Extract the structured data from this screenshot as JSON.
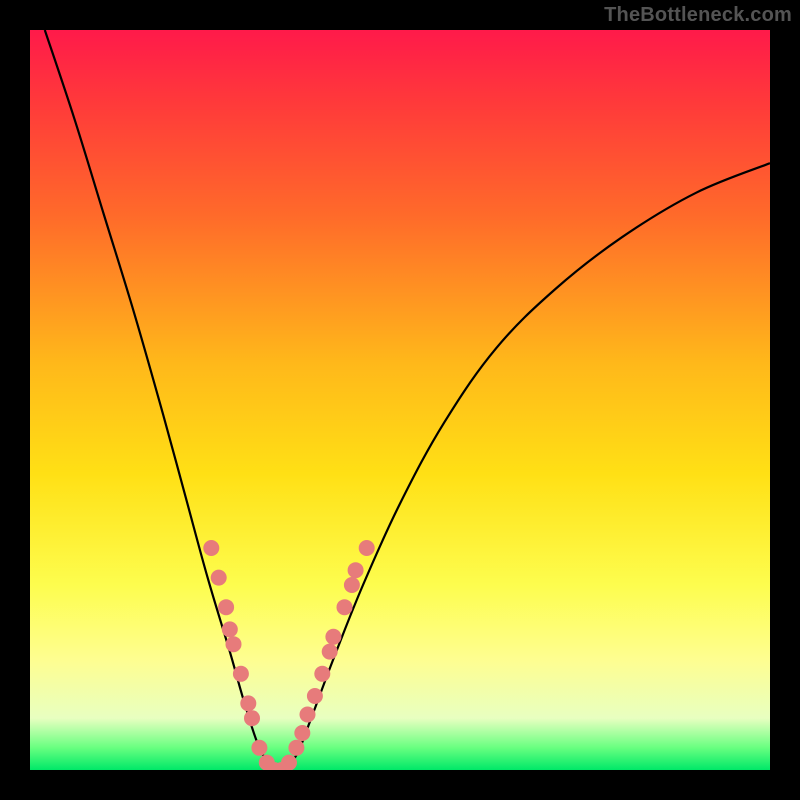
{
  "watermark": "TheBottleneck.com",
  "chart_data": {
    "type": "line",
    "title": "",
    "xlabel": "",
    "ylabel": "",
    "xlim": [
      0,
      100
    ],
    "ylim": [
      0,
      100
    ],
    "grid": false,
    "legend": false,
    "background_gradient": {
      "top": "#ff1a4a",
      "mid": "#ffe015",
      "bottom": "#00e868"
    },
    "curve": [
      {
        "x": 2,
        "y": 100
      },
      {
        "x": 6,
        "y": 88
      },
      {
        "x": 10,
        "y": 75
      },
      {
        "x": 14,
        "y": 62
      },
      {
        "x": 18,
        "y": 48
      },
      {
        "x": 21,
        "y": 37
      },
      {
        "x": 24,
        "y": 26
      },
      {
        "x": 27,
        "y": 16
      },
      {
        "x": 29,
        "y": 9
      },
      {
        "x": 31,
        "y": 3
      },
      {
        "x": 33,
        "y": 0
      },
      {
        "x": 34,
        "y": 0
      },
      {
        "x": 36,
        "y": 2
      },
      {
        "x": 38,
        "y": 7
      },
      {
        "x": 41,
        "y": 15
      },
      {
        "x": 45,
        "y": 25
      },
      {
        "x": 50,
        "y": 36
      },
      {
        "x": 56,
        "y": 47
      },
      {
        "x": 63,
        "y": 57
      },
      {
        "x": 71,
        "y": 65
      },
      {
        "x": 80,
        "y": 72
      },
      {
        "x": 90,
        "y": 78
      },
      {
        "x": 100,
        "y": 82
      }
    ],
    "dots": [
      {
        "x": 24.5,
        "y": 30
      },
      {
        "x": 25.5,
        "y": 26
      },
      {
        "x": 26.5,
        "y": 22
      },
      {
        "x": 27,
        "y": 19
      },
      {
        "x": 27.5,
        "y": 17
      },
      {
        "x": 28.5,
        "y": 13
      },
      {
        "x": 29.5,
        "y": 9
      },
      {
        "x": 30,
        "y": 7
      },
      {
        "x": 31,
        "y": 3
      },
      {
        "x": 32,
        "y": 1
      },
      {
        "x": 33,
        "y": 0
      },
      {
        "x": 34,
        "y": 0
      },
      {
        "x": 35,
        "y": 1
      },
      {
        "x": 36,
        "y": 3
      },
      {
        "x": 36.8,
        "y": 5
      },
      {
        "x": 37.5,
        "y": 7.5
      },
      {
        "x": 38.5,
        "y": 10
      },
      {
        "x": 39.5,
        "y": 13
      },
      {
        "x": 40.5,
        "y": 16
      },
      {
        "x": 41,
        "y": 18
      },
      {
        "x": 42.5,
        "y": 22
      },
      {
        "x": 43.5,
        "y": 25
      },
      {
        "x": 44,
        "y": 27
      },
      {
        "x": 45.5,
        "y": 30
      }
    ],
    "dot_color": "#e77b7b",
    "dot_radius": 8
  }
}
